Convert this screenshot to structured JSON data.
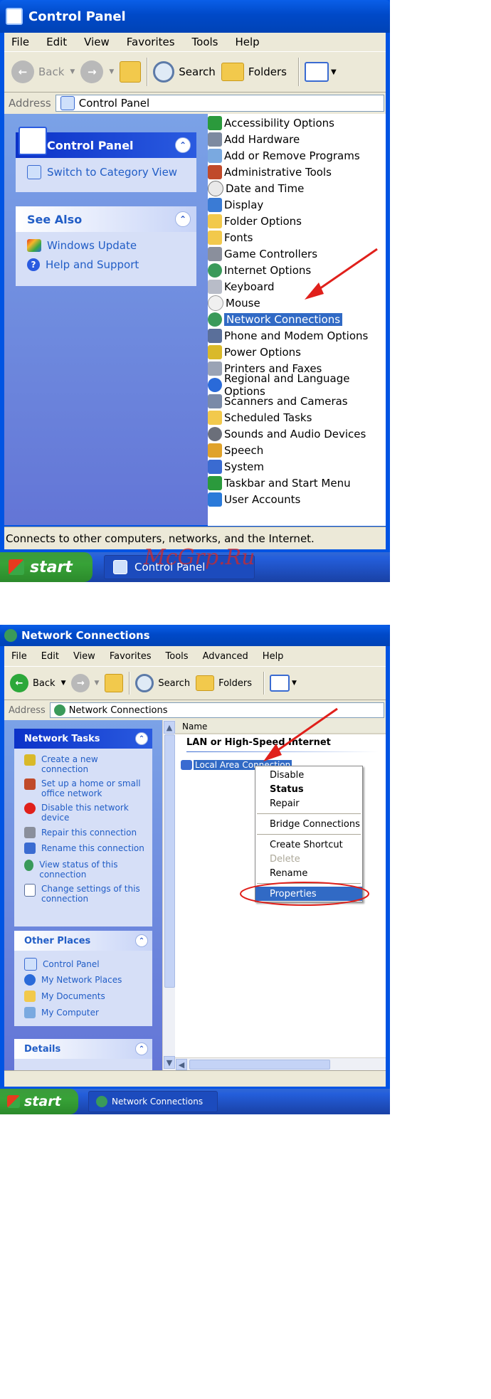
{
  "window1": {
    "title": "Control Panel",
    "menu": [
      "File",
      "Edit",
      "View",
      "Favorites",
      "Tools",
      "Help"
    ],
    "toolbar": {
      "back": "Back",
      "search": "Search",
      "folders": "Folders"
    },
    "address": {
      "label": "Address",
      "value": "Control Panel"
    },
    "left": {
      "cp_title": "Control Panel",
      "switch_view": "Switch to Category View",
      "see_also_title": "See Also",
      "see_also": [
        "Windows Update",
        "Help and Support"
      ]
    },
    "items": [
      "Accessibility Options",
      "Add Hardware",
      "Add or Remove Programs",
      "Administrative Tools",
      "Date and Time",
      "Display",
      "Folder Options",
      "Fonts",
      "Game Controllers",
      "Internet Options",
      "Keyboard",
      "Mouse",
      "Network Connections",
      "Phone and Modem Options",
      "Power Options",
      "Printers and Faxes",
      "Regional and Language Options",
      "Scanners and Cameras",
      "Scheduled Tasks",
      "Sounds and Audio Devices",
      "Speech",
      "System",
      "Taskbar and Start Menu",
      "User Accounts"
    ],
    "selected_item": "Network Connections",
    "status": "Connects to other computers, networks, and the Internet.",
    "taskbar": {
      "start": "start",
      "task": "Control Panel"
    },
    "watermark": "McGrp.Ru"
  },
  "window2": {
    "title": "Network Connections",
    "menu": [
      "File",
      "Edit",
      "View",
      "Favorites",
      "Tools",
      "Advanced",
      "Help"
    ],
    "toolbar": {
      "back": "Back",
      "search": "Search",
      "folders": "Folders"
    },
    "address": {
      "label": "Address",
      "value": "Network Connections"
    },
    "network_tasks_title": "Network Tasks",
    "network_tasks": [
      "Create a new connection",
      "Set up a home or small office network",
      "Disable this network device",
      "Repair this connection",
      "Rename this connection",
      "View status of this connection",
      "Change settings of this connection"
    ],
    "other_places_title": "Other Places",
    "other_places": [
      "Control Panel",
      "My Network Places",
      "My Documents",
      "My Computer"
    ],
    "details_title": "Details",
    "column_header": "Name",
    "group_header": "LAN or High-Speed Internet",
    "connection_label": "Local Area Connection",
    "context_menu": {
      "disable": "Disable",
      "status": "Status",
      "repair": "Repair",
      "bridge": "Bridge Connections",
      "shortcut": "Create Shortcut",
      "delete": "Delete",
      "rename": "Rename",
      "properties": "Properties"
    },
    "taskbar": {
      "start": "start",
      "task": "Network Connections"
    }
  },
  "colors": {
    "xp_blue": "#0054e3",
    "selection": "#316ac5",
    "annotation_red": "#e0201b"
  }
}
